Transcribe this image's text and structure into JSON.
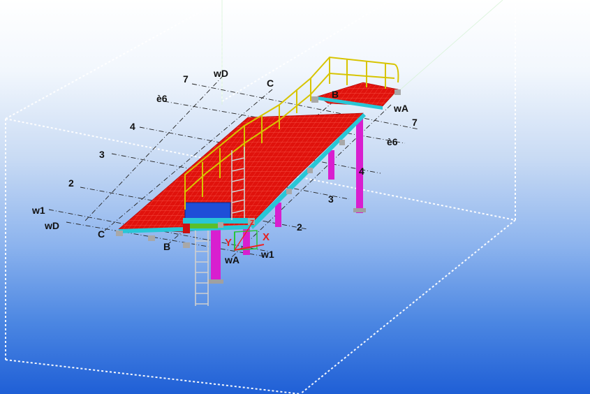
{
  "viewport": {
    "title": "3D model view",
    "background_top": "#ffffff",
    "background_bottom": "#1f5fd6"
  },
  "gridlines": {
    "left": {
      "l7": "7",
      "wD_top": "wD",
      "C_top": "C",
      "g6": "è6",
      "l4": "4",
      "l3": "3",
      "l2": "2",
      "w1": "w1",
      "wD": "wD",
      "C": "C",
      "B": "B"
    },
    "right": {
      "B_top": "B",
      "wA_top": "wA",
      "l7": "7",
      "g6": "è6",
      "l4": "4",
      "l3": "3",
      "l2": "2",
      "wA": "wA",
      "w1": "w1"
    }
  },
  "work_plane": {
    "x_label": "X",
    "y_label": "Y",
    "z_label": "Z"
  },
  "colors": {
    "deck": "#e0120c",
    "deck_grid": "#ff6a5a",
    "column": "#d81fcf",
    "beam": "#29c6d6",
    "handrail": "#d7c400",
    "ladder": "#c8c8c8",
    "hatch": "#1e4ed8",
    "bbox": "#ffffff"
  }
}
